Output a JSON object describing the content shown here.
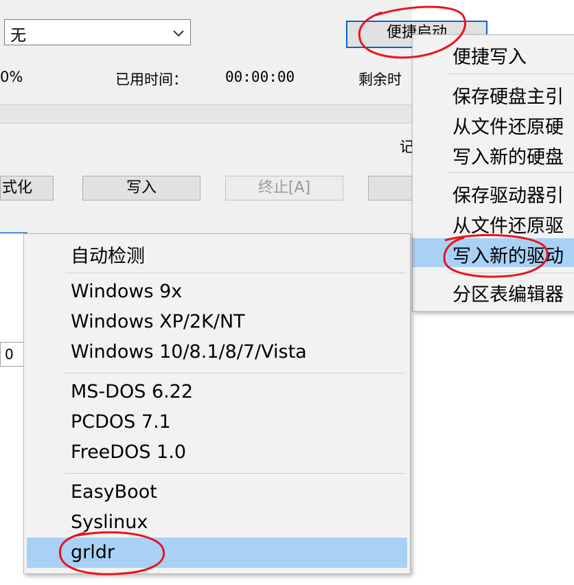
{
  "dialog": {
    "combo_value": "无",
    "quick_boot_label": "便捷启动",
    "progress_percent": "0%",
    "elapsed_label": "已用时间：",
    "elapsed_value": "00:00:00",
    "remaining_label": "剩余时",
    "partial_char": "记",
    "format_label": "式化",
    "write_label": "写入",
    "stop_label": "终止[A]",
    "field_value": "0"
  },
  "right_menu": {
    "items": [
      "便捷写入",
      "保存硬盘主引",
      "从文件还原硬",
      "写入新的硬盘",
      "保存驱动器引",
      "从文件还原驱",
      "写入新的驱动",
      "分区表编辑器"
    ]
  },
  "left_menu": {
    "items": [
      "自动检测",
      "Windows 9x",
      "Windows XP/2K/NT",
      "Windows 10/8.1/8/7/Vista",
      "MS-DOS 6.22",
      "PCDOS 7.1",
      "FreeDOS 1.0",
      "EasyBoot",
      "Syslinux",
      "grldr"
    ]
  },
  "colors": {
    "highlight": "#a9d0f5",
    "annotation": "#e8141c",
    "focus_border": "#0a64c8"
  }
}
